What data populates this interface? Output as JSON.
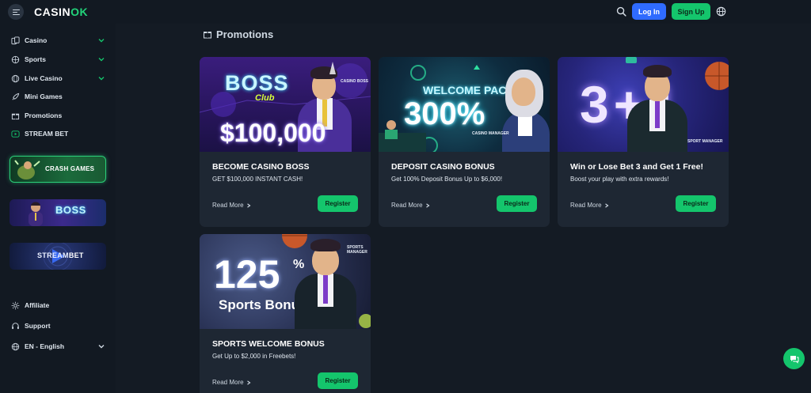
{
  "header": {
    "logo_main": "CASIN",
    "logo_accent": "OK",
    "login_label": "Log In",
    "signup_label": "Sign Up"
  },
  "sidebar": {
    "items": [
      {
        "label": "Casino",
        "icon": "cards-icon",
        "has_chevron": true
      },
      {
        "label": "Sports",
        "icon": "sports-icon",
        "has_chevron": true
      },
      {
        "label": "Live Casino",
        "icon": "live-icon",
        "has_chevron": true
      },
      {
        "label": "Mini Games",
        "icon": "rocket-icon",
        "has_chevron": false
      },
      {
        "label": "Promotions",
        "icon": "gift-icon",
        "has_chevron": false
      },
      {
        "label": "STREAM BET",
        "icon": "play-icon",
        "has_chevron": false
      }
    ],
    "banners": {
      "crash": "CRASH GAMES",
      "boss": "BOSS",
      "stream_a": "STREAM",
      "stream_b": "BET"
    },
    "footer": {
      "affiliate": "Affiliate",
      "support": "Support",
      "language": "EN - English"
    }
  },
  "main": {
    "title": "Promotions",
    "cards": [
      {
        "title": "BECOME CASINO BOSS",
        "desc": "GET $100,000 INSTANT CASH!",
        "read_more": "Read More",
        "register": "Register",
        "art": {
          "logo": "BOSS",
          "club": "Club",
          "amount": "$100,000",
          "caption": "CASINO BOSS"
        }
      },
      {
        "title": "DEPOSIT CASINO BONUS",
        "desc": "Get 100% Deposit Bonus Up to $6,000!",
        "read_more": "Read More",
        "register": "Register",
        "art": {
          "headline": "WELCOME PACK",
          "amount": "300%",
          "caption": "CASINO MANAGER"
        }
      },
      {
        "title": "Win or Lose Bet 3 and Get 1 Free!",
        "desc": "Boost your play with extra rewards!",
        "read_more": "Read More",
        "register": "Register",
        "art": {
          "big": "3+1",
          "caption": "SPORT MANAGER"
        }
      },
      {
        "title": "SPORTS WELCOME BONUS",
        "desc": "Get Up to $2,000 in Freebets!",
        "read_more": "Read More",
        "register": "Register",
        "art": {
          "amount": "125",
          "pct": "%",
          "headline": "Sports Bonus",
          "caption": "SPORTS MANAGER"
        }
      }
    ]
  },
  "colors": {
    "background": "#141b24",
    "sidebar": "#121922",
    "card": "#1e2733",
    "accent_green": "#14c56c",
    "login_blue": "#2f6bff"
  }
}
